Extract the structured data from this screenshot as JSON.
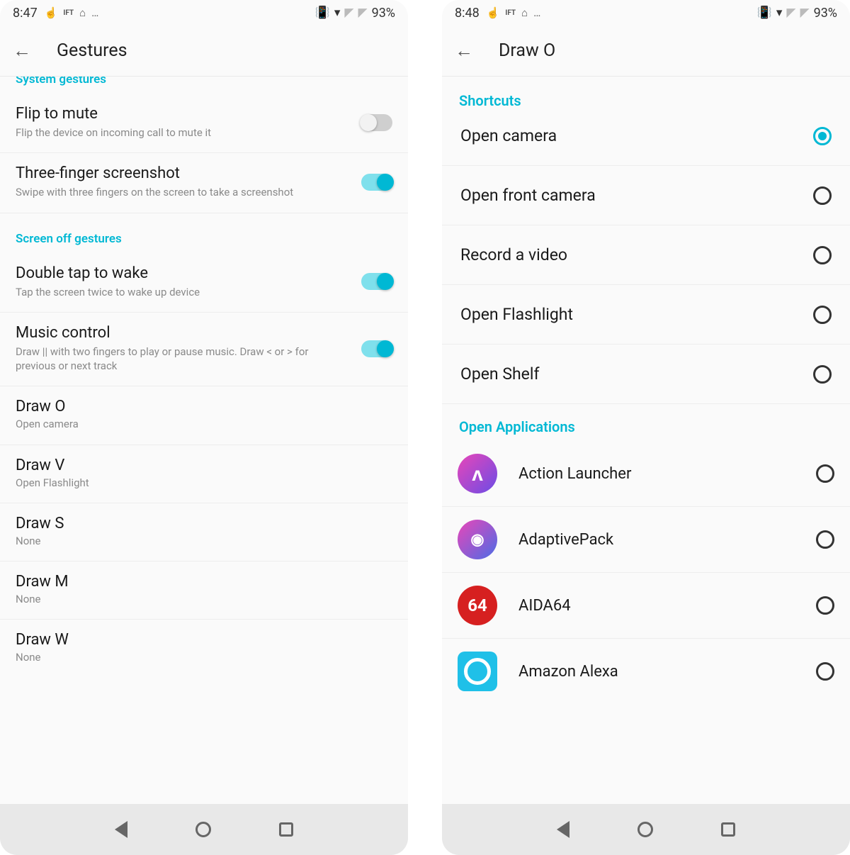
{
  "left": {
    "status": {
      "time": "8:47",
      "battery": "93%"
    },
    "title": "Gestures",
    "section1": "System gestures",
    "flip": {
      "title": "Flip to mute",
      "sub": "Flip the device on incoming call to mute it"
    },
    "three": {
      "title": "Three-finger screenshot",
      "sub": "Swipe with three fingers on the screen to take a screenshot"
    },
    "section2": "Screen off gestures",
    "dtap": {
      "title": "Double tap to wake",
      "sub": "Tap the screen twice to wake up device"
    },
    "music": {
      "title": "Music control",
      "sub": "Draw || with two fingers to play or pause music. Draw < or > for previous or next track"
    },
    "drawO": {
      "title": "Draw O",
      "sub": "Open camera"
    },
    "drawV": {
      "title": "Draw V",
      "sub": "Open Flashlight"
    },
    "drawS": {
      "title": "Draw S",
      "sub": "None"
    },
    "drawM": {
      "title": "Draw M",
      "sub": "None"
    },
    "drawW": {
      "title": "Draw W",
      "sub": "None"
    }
  },
  "right": {
    "status": {
      "time": "8:48",
      "battery": "93%"
    },
    "title": "Draw O",
    "section1": "Shortcuts",
    "sc": {
      "camera": "Open camera",
      "front": "Open front camera",
      "video": "Record a video",
      "flash": "Open Flashlight",
      "shelf": "Open Shelf"
    },
    "section2": "Open Applications",
    "apps": {
      "action": "Action Launcher",
      "adaptive": "AdaptivePack",
      "aida": "AIDA64",
      "alexa": "Amazon Alexa"
    }
  }
}
